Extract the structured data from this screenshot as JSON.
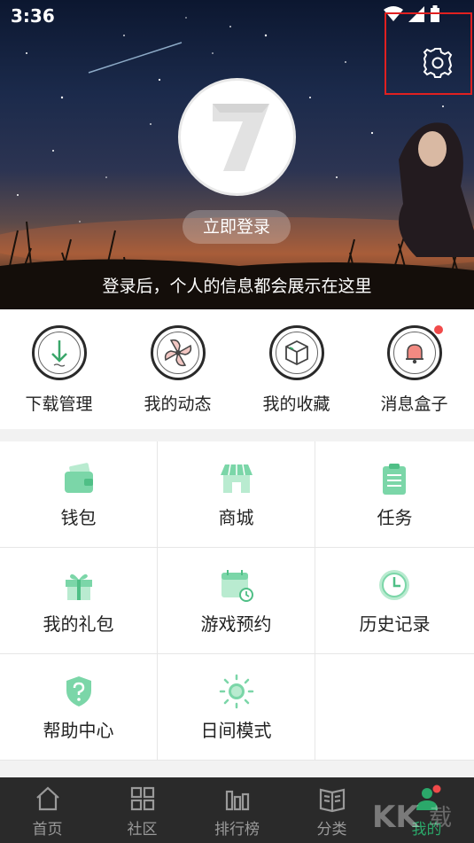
{
  "status_bar": {
    "time": "3:36"
  },
  "header": {
    "login_button": "立即登录",
    "login_hint": "登录后，个人的信息都会展示在这里"
  },
  "quick_actions": [
    {
      "label": "下载管理",
      "icon": "download-icon"
    },
    {
      "label": "我的动态",
      "icon": "pinwheel-icon"
    },
    {
      "label": "我的收藏",
      "icon": "box-icon"
    },
    {
      "label": "消息盒子",
      "icon": "bell-icon",
      "badge": true
    }
  ],
  "grid_items": [
    {
      "label": "钱包",
      "icon": "wallet-icon"
    },
    {
      "label": "商城",
      "icon": "shop-icon"
    },
    {
      "label": "任务",
      "icon": "clipboard-icon"
    },
    {
      "label": "我的礼包",
      "icon": "gift-icon"
    },
    {
      "label": "游戏预约",
      "icon": "calendar-icon"
    },
    {
      "label": "历史记录",
      "icon": "clock-icon"
    },
    {
      "label": "帮助中心",
      "icon": "shield-question-icon"
    },
    {
      "label": "日间模式",
      "icon": "sun-icon"
    }
  ],
  "tabs": [
    {
      "label": "首页",
      "icon": "home-icon"
    },
    {
      "label": "社区",
      "icon": "grid-icon"
    },
    {
      "label": "排行榜",
      "icon": "chart-icon"
    },
    {
      "label": "分类",
      "icon": "book-icon"
    },
    {
      "label": "我的",
      "icon": "user-icon",
      "active": true
    }
  ],
  "colors": {
    "accent": "#2ba86a",
    "icon_green": "#7bd6a8",
    "alert": "#f14a4a",
    "highlight_box": "#e02020"
  }
}
